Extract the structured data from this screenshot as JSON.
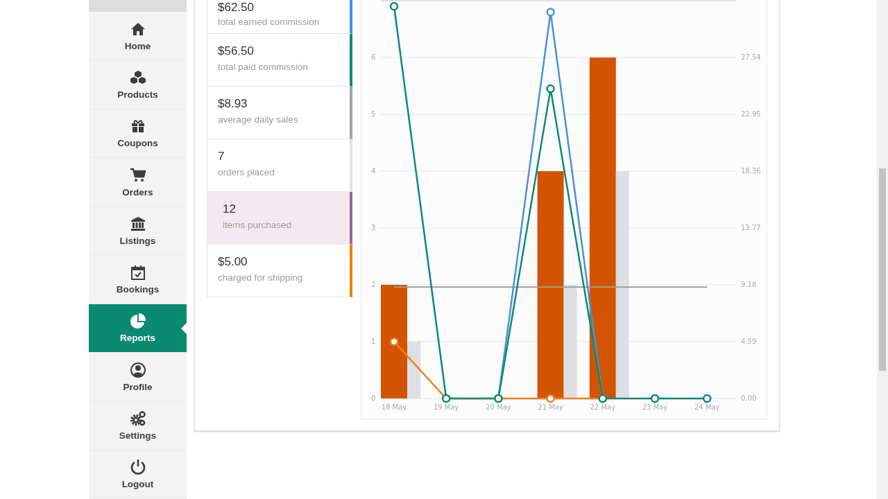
{
  "sidebar": {
    "items": [
      {
        "label": "Home",
        "selected": false
      },
      {
        "label": "Products",
        "selected": false
      },
      {
        "label": "Coupons",
        "selected": false
      },
      {
        "label": "Orders",
        "selected": false
      },
      {
        "label": "Listings",
        "selected": false
      },
      {
        "label": "Bookings",
        "selected": false
      },
      {
        "label": "Reports",
        "selected": true
      },
      {
        "label": "Profile",
        "selected": false
      },
      {
        "label": "Settings",
        "selected": false
      },
      {
        "label": "Logout",
        "selected": false
      }
    ]
  },
  "stats": [
    {
      "value": "$62.50",
      "label": "total earned commission",
      "color": "#4a90e2",
      "highlighted": false
    },
    {
      "value": "$56.50",
      "label": "total paid commission",
      "color": "#0e8a74",
      "highlighted": false
    },
    {
      "value": "$8.93",
      "label": "average daily sales",
      "color": "#a3a3a3",
      "highlighted": false
    },
    {
      "value": "7",
      "label": "orders placed",
      "color": "#dfe2e6",
      "highlighted": false
    },
    {
      "value": "12",
      "label": "items purchased",
      "color": "#9a6b8c",
      "highlighted": true
    },
    {
      "value": "$5.00",
      "label": "charged for shipping",
      "color": "#f57c00",
      "highlighted": false
    }
  ],
  "chart": {
    "chart_data": {
      "type": "bar",
      "categories": [
        "18 May",
        "19 May",
        "20 May",
        "21 May",
        "22 May",
        "23 May",
        "24 May"
      ],
      "ylim": [
        0,
        7
      ],
      "yticks": [
        0,
        1,
        2,
        3,
        4,
        5,
        6
      ],
      "y2ticks": [
        "0.00",
        "4.59",
        "9.18",
        "13.77",
        "18.36",
        "22.95",
        "27.54"
      ],
      "series": [
        {
          "type": "bar",
          "color": "#d35400",
          "values": [
            2,
            0,
            0,
            4,
            6,
            0,
            0
          ]
        },
        {
          "type": "bar",
          "color": "#dcdfe3",
          "values": [
            1,
            0,
            0,
            2,
            4,
            0,
            0
          ]
        },
        {
          "type": "line",
          "marker": "none",
          "color": "#9e9e9e",
          "values": [
            1.96,
            1.96,
            1.96,
            1.96,
            1.96,
            1.96,
            1.96
          ]
        },
        {
          "type": "line",
          "marker": "circle",
          "color": "#f07f1a",
          "values": [
            1,
            0,
            0,
            0,
            0,
            null,
            null
          ]
        },
        {
          "type": "line",
          "marker": "circle",
          "color": "#4a90d9",
          "values": [
            null,
            null,
            0,
            6.8,
            0,
            null,
            null
          ]
        },
        {
          "type": "line",
          "marker": "circle",
          "color": "#0b8a72",
          "values": [
            6.9,
            0,
            0,
            5.45,
            0,
            0,
            0
          ]
        }
      ]
    }
  }
}
